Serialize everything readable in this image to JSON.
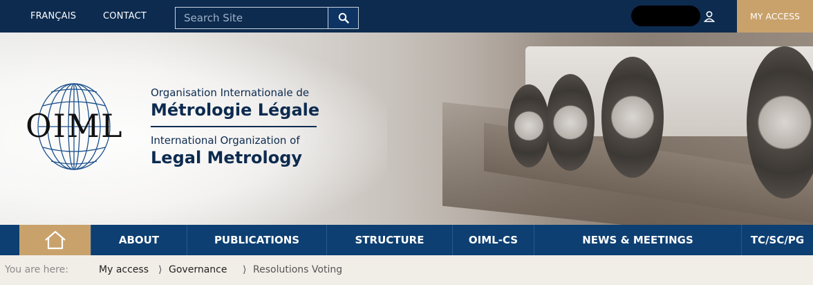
{
  "topbar": {
    "language_link": "FRANÇAIS",
    "contact_link": "CONTACT",
    "search_placeholder": "Search Site",
    "my_access_label": "MY ACCESS"
  },
  "logo": {
    "acronym": "OIML",
    "line1": "Organisation Internationale de",
    "line2": "Métrologie Légale",
    "line3": "International Organization of",
    "line4": "Legal Metrology"
  },
  "nav": {
    "items": [
      {
        "label": "ABOUT"
      },
      {
        "label": "PUBLICATIONS"
      },
      {
        "label": "STRUCTURE"
      },
      {
        "label": "OIML-CS"
      },
      {
        "label": "NEWS & MEETINGS"
      },
      {
        "label": "TC/SC/PG"
      }
    ]
  },
  "breadcrumb": {
    "prefix": "You are here:",
    "items": [
      "My access",
      "Governance",
      "Resolutions Voting"
    ],
    "separator": "⟩"
  },
  "colors": {
    "navy": "#0d2b4f",
    "nav_blue": "#0d3f72",
    "gold": "#c9a26b",
    "breadcrumb_bg": "#f1ede7"
  }
}
